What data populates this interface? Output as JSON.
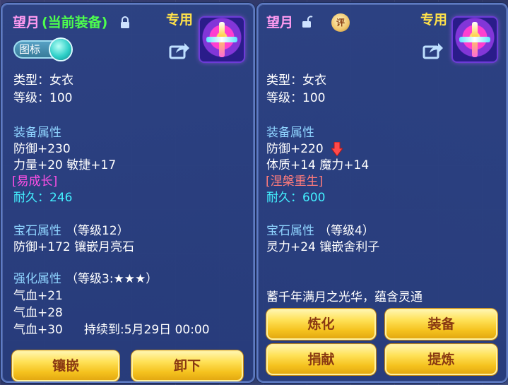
{
  "left_panel": {
    "title_name": "望月",
    "title_status": "(当前装备)",
    "exclusive_tag": "专用",
    "icon_toggle_label": "图标",
    "type_line": "类型：女衣",
    "level_line": "等级：100",
    "equip_attr_header": "装备属性",
    "equip_attrs": [
      "防御+230",
      "力量+20 敏捷+17"
    ],
    "special_trait": "[易成长]",
    "durability_line": "耐久：246",
    "gem_header": "宝石属性",
    "gem_level": "（等级12）",
    "gem_detail": "防御+172 镶嵌月亮石",
    "enhance_header": "强化属性",
    "enhance_level": "（等级3:★★★）",
    "enhance_lines": [
      "气血+21",
      "气血+28",
      "气血+30"
    ],
    "duration_text": "持续到:5月29日 00:00",
    "buttons": {
      "inlay": "镶嵌",
      "unequip": "卸下"
    }
  },
  "right_panel": {
    "title_name": "望月",
    "eval_badge": "评",
    "exclusive_tag": "专用",
    "type_line": "类型：女衣",
    "level_line": "等级：100",
    "equip_attr_header": "装备属性",
    "equip_attrs": [
      "防御+220",
      "体质+14 魔力+14"
    ],
    "special_trait": "[涅槃重生]",
    "durability_line": "耐久：600",
    "gem_header": "宝石属性",
    "gem_level": "（等级4）",
    "gem_detail": "灵力+24 镶嵌舍利子",
    "description": "蓄千年满月之光华，蕴含灵通",
    "buttons": {
      "refine": "炼化",
      "equip": "装备",
      "donate": "捐献",
      "extract": "提炼"
    }
  },
  "colors": {
    "title": "#ff9bf1",
    "status_green": "#4dff4d",
    "exclusive_yellow": "#ffe14a",
    "section_blue": "#8fd4ff",
    "durability_cyan": "#43f0ff",
    "trait_magenta": "#ff4fe6",
    "trait_red": "#ff7b7b",
    "button_text": "#8a3a12"
  },
  "icons": [
    "lock-closed-icon",
    "lock-open-icon",
    "share-icon",
    "item-icon",
    "down-arrow-icon",
    "evaluate-badge"
  ]
}
